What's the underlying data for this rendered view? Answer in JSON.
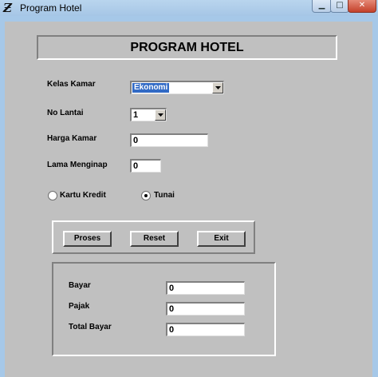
{
  "window": {
    "title": "Program Hotel",
    "app_icon": "vb-app-icon",
    "controls": {
      "minimize": "minimize-icon",
      "maximize": "maximize-icon",
      "close": "close-icon"
    }
  },
  "header": {
    "title": "PROGRAM HOTEL"
  },
  "form": {
    "kelas_kamar": {
      "label": "Kelas Kamar",
      "value": "Ekonomi"
    },
    "no_lantai": {
      "label": "No Lantai",
      "value": "1"
    },
    "harga_kamar": {
      "label": "Harga Kamar",
      "value": "0"
    },
    "lama_menginap": {
      "label": "Lama Menginap",
      "value": "0"
    },
    "payment": {
      "kartu_kredit": {
        "label": "Kartu Kredit",
        "selected": false
      },
      "tunai": {
        "label": "Tunai",
        "selected": true
      }
    }
  },
  "buttons": {
    "proses": "Proses",
    "reset": "Reset",
    "exit": "Exit"
  },
  "results": {
    "bayar": {
      "label": "Bayar",
      "value": "0"
    },
    "pajak": {
      "label": "Pajak",
      "value": "0"
    },
    "total_bayar": {
      "label": "Total Bayar",
      "value": "0"
    }
  }
}
